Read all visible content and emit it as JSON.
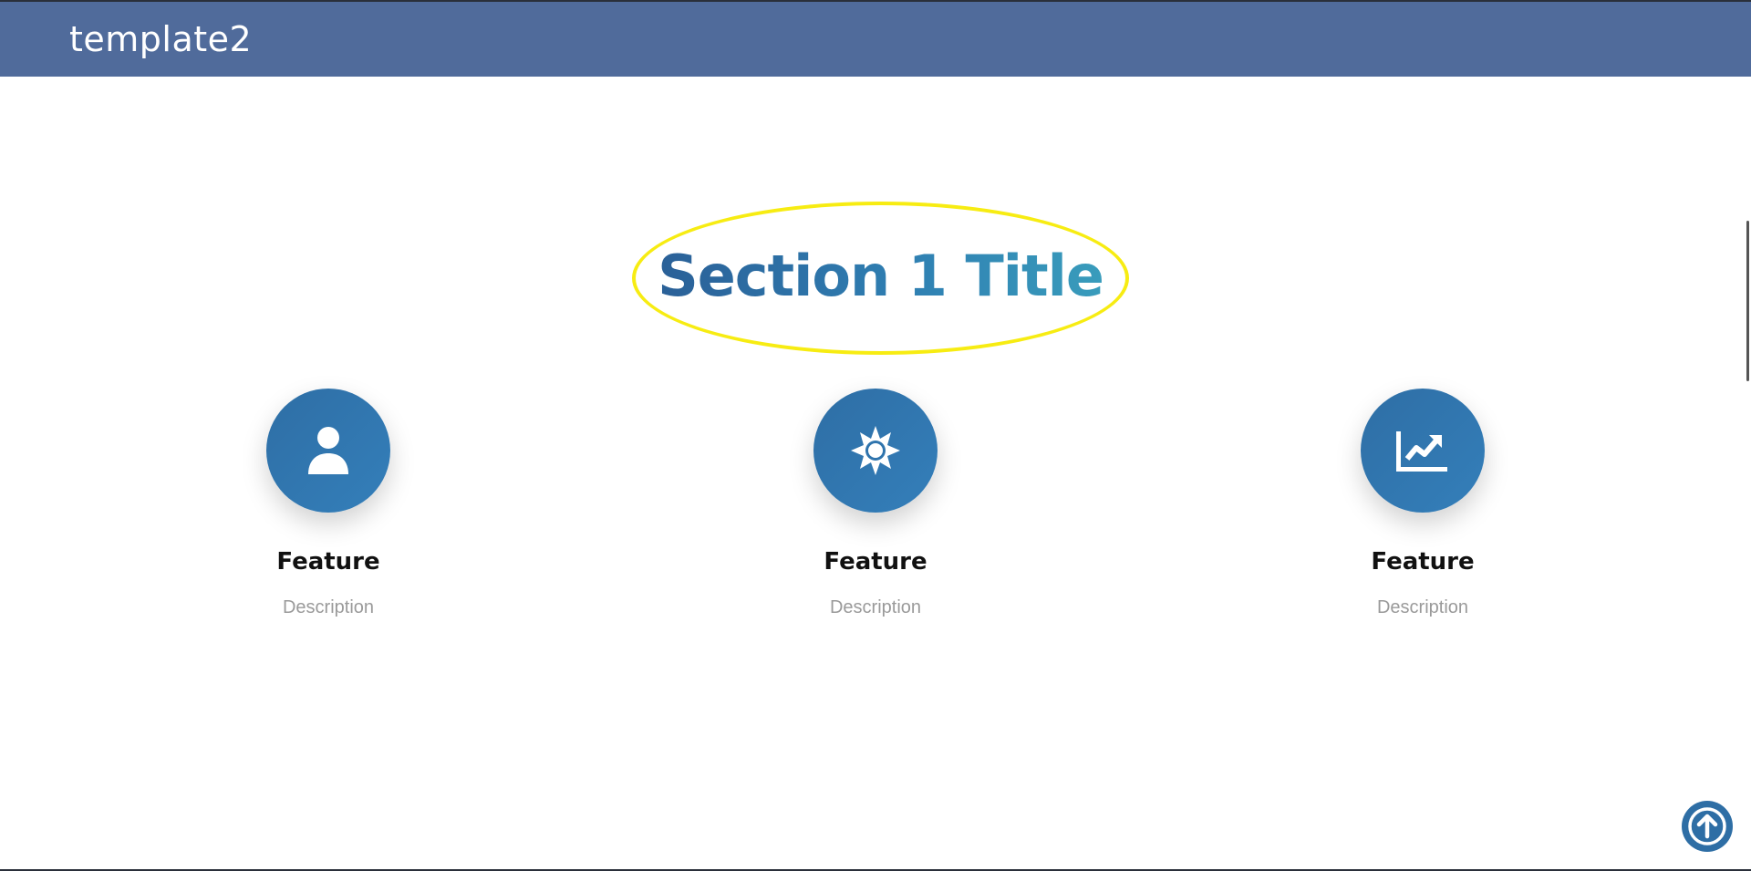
{
  "header": {
    "brand": "template2"
  },
  "section": {
    "title": "Section 1 Title"
  },
  "features": [
    {
      "icon": "user-icon",
      "title": "Feature",
      "description": "Description"
    },
    {
      "icon": "sun-icon",
      "title": "Feature",
      "description": "Description"
    },
    {
      "icon": "chart-line-icon",
      "title": "Feature",
      "description": "Description"
    }
  ],
  "back_to_top": {
    "icon": "arrow-up-icon"
  },
  "colors": {
    "header_bg": "#506b9b",
    "accent": "#2e6ea5",
    "title_highlight": "#f7ec12"
  }
}
